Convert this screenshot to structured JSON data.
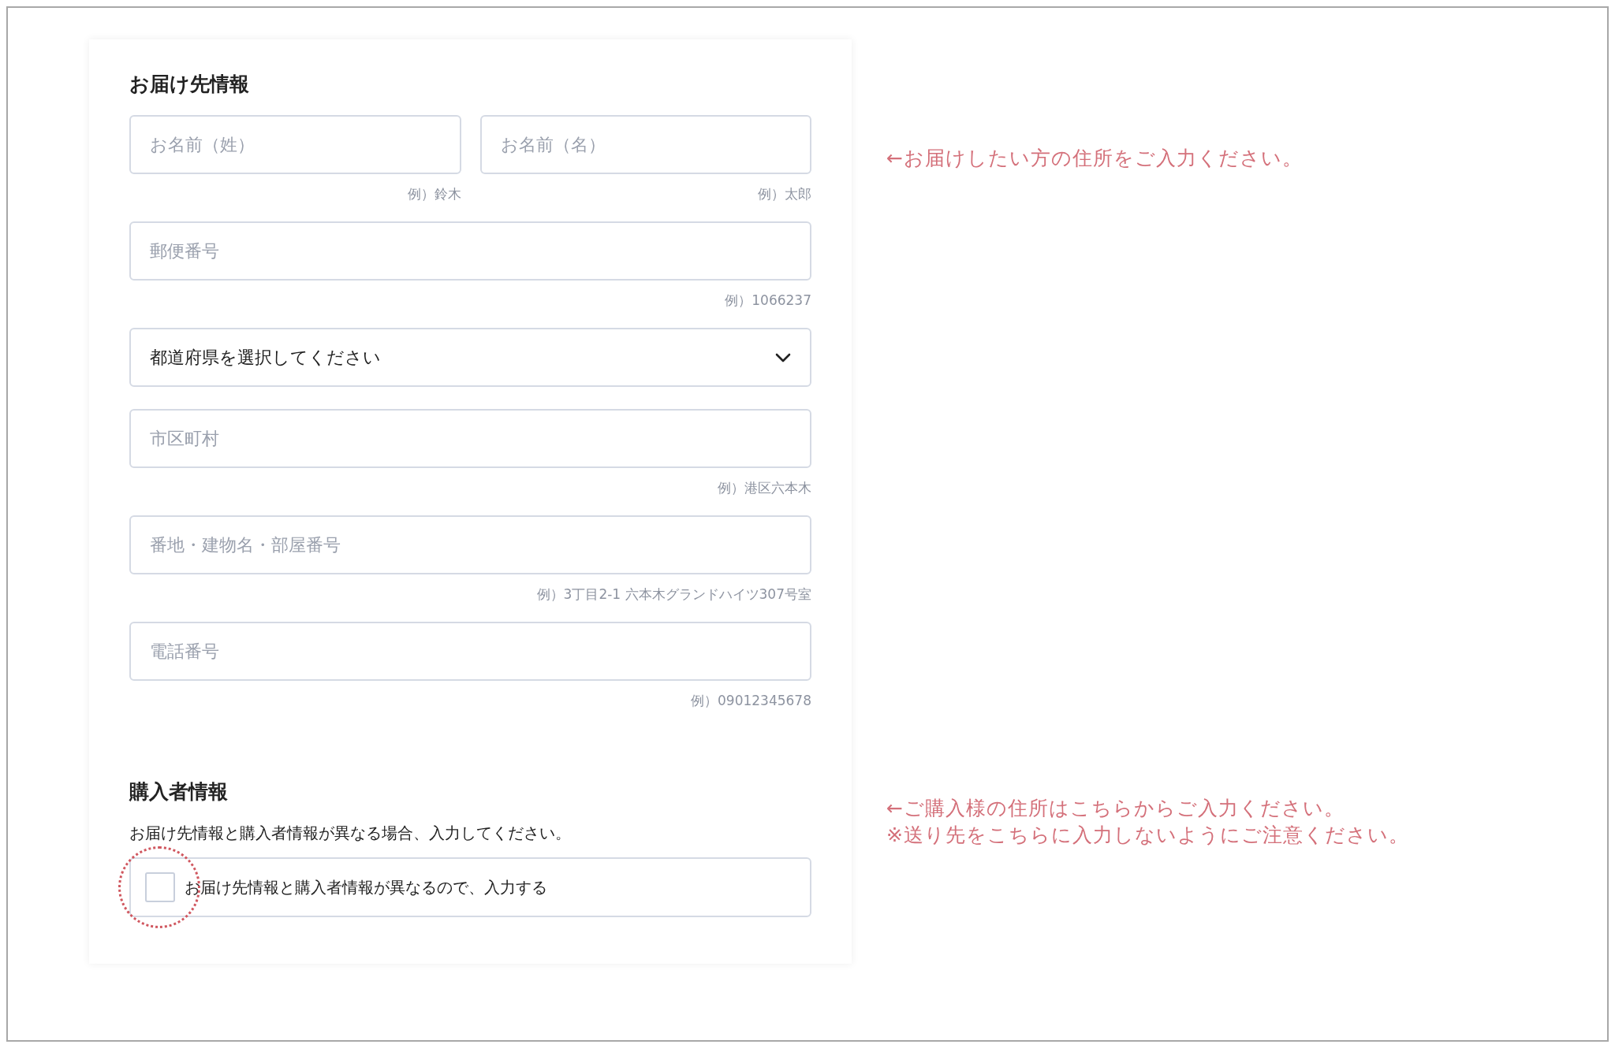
{
  "delivery": {
    "title": "お届け先情報",
    "rows": [
      {
        "fields": [
          {
            "kind": "input",
            "placeholder": "お名前（姓）",
            "hint": "例）鈴木"
          },
          {
            "kind": "input",
            "placeholder": "お名前（名）",
            "hint": "例）太郎"
          }
        ]
      },
      {
        "fields": [
          {
            "kind": "input",
            "placeholder": "郵便番号",
            "hint": "例）1066237"
          }
        ]
      },
      {
        "fields": [
          {
            "kind": "select",
            "value": "都道府県を選択してください"
          }
        ]
      },
      {
        "fields": [
          {
            "kind": "input",
            "placeholder": "市区町村",
            "hint": "例）港区六本木"
          }
        ]
      },
      {
        "fields": [
          {
            "kind": "input",
            "placeholder": "番地・建物名・部屋番号",
            "hint": "例）3丁目2-1 六本木グランドハイツ307号室"
          }
        ]
      },
      {
        "fields": [
          {
            "kind": "input",
            "placeholder": "電話番号",
            "hint": "例）09012345678"
          }
        ]
      }
    ]
  },
  "buyer": {
    "title": "購入者情報",
    "description": "お届け先情報と購入者情報が異なる場合、入力してください。",
    "checkbox": {
      "label": "お届け先情報と購入者情報が異なるので、入力する",
      "checked": false,
      "highlighted": true
    }
  },
  "notes": [
    {
      "lines": [
        "←お届けしたい方の住所をご入力ください。"
      ]
    },
    {
      "lines": [
        "←ご購入様の住所はこちらからご入力ください。",
        "※送り先をこちらに入力しないようにご注意ください。"
      ]
    }
  ]
}
